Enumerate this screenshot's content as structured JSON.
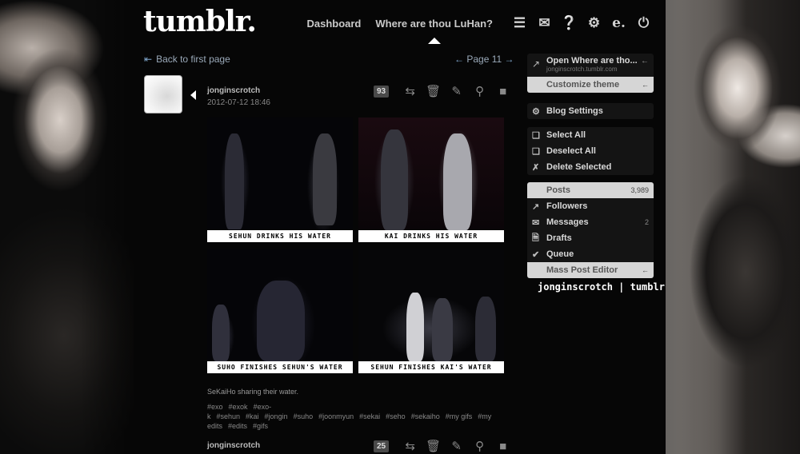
{
  "logo": "tumblr.",
  "nav": {
    "dashboard": "Dashboard",
    "blog": "Where are thou LuHan?"
  },
  "icons": [
    "list-icon",
    "mail-icon",
    "help-icon",
    "gear-icon",
    "e-icon",
    "power-icon"
  ],
  "back_link": "Back to first page",
  "page_link": "Page 11",
  "post1": {
    "user": "jonginscrotch",
    "date": "2012-07-12 18:46",
    "notes": "93",
    "gifs": [
      {
        "caption": "Sehun drinks his water"
      },
      {
        "caption": "Kai drinks his water"
      },
      {
        "caption": "Suho finishes Sehun's water"
      },
      {
        "caption": "Sehun finishes Kai's water"
      }
    ],
    "caption": "SeKaiHo sharing their water.",
    "tags": [
      "#exo",
      "#exok",
      "#exo-k",
      "#sehun",
      "#kai",
      "#jongin",
      "#suho",
      "#joonmyun",
      "#sekai",
      "#seho",
      "#sekaiho",
      "#my gifs",
      "#my edits",
      "#edits",
      "#gifs"
    ]
  },
  "post2": {
    "user": "jonginscrotch",
    "notes": "25"
  },
  "sidebar": {
    "open_title": "Open Where are tho...",
    "open_url": "jonginscrotch.tumblr.com",
    "customize": "Customize theme",
    "blog_settings": "Blog Settings",
    "select_all": "Select All",
    "deselect_all": "Deselect All",
    "delete_selected": "Delete Selected",
    "posts": "Posts",
    "posts_count": "3,989",
    "followers": "Followers",
    "messages": "Messages",
    "messages_count": "2",
    "drafts": "Drafts",
    "queue": "Queue",
    "mass_editor": "Mass Post Editor",
    "signature": "jonginscrotch | tumblr"
  }
}
